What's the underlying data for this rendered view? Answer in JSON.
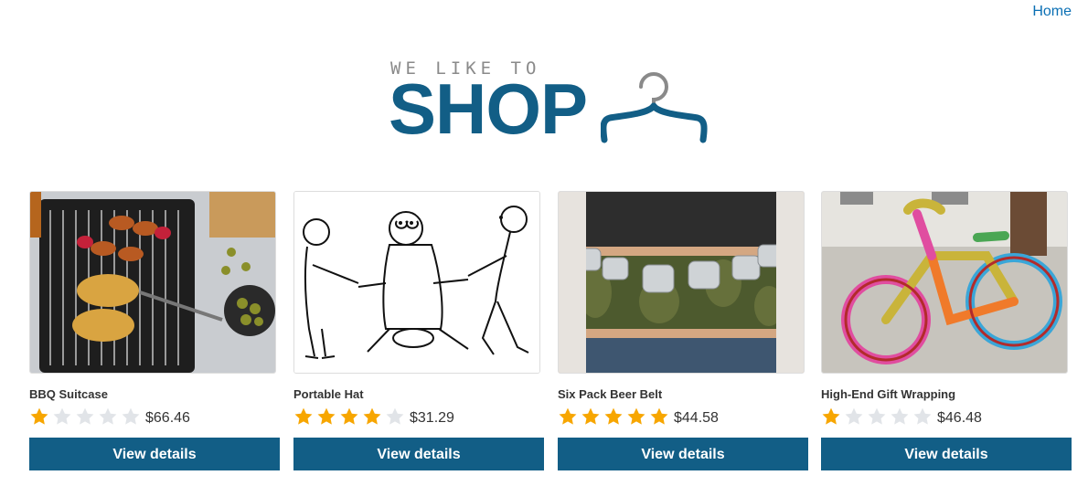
{
  "nav": {
    "home_label": "Home"
  },
  "logo": {
    "tagline": "WE LIKE TO",
    "word": "SHOP",
    "icon": "hanger-icon"
  },
  "colors": {
    "brand": "#125e86",
    "link": "#0a6fb4",
    "star_on": "#f7a600",
    "star_off": "#e1e4e8"
  },
  "products": [
    {
      "name": "BBQ Suitcase",
      "rating": 1,
      "max_rating": 5,
      "price": "$66.46",
      "button": "View details",
      "image": "bbq-grill-image"
    },
    {
      "name": "Portable Hat",
      "rating": 4,
      "max_rating": 5,
      "price": "$31.29",
      "button": "View details",
      "image": "cartoon-sketch-image"
    },
    {
      "name": "Six Pack Beer Belt",
      "rating": 5,
      "max_rating": 5,
      "price": "$44.58",
      "button": "View details",
      "image": "beer-belt-image"
    },
    {
      "name": "High-End Gift Wrapping",
      "rating": 1,
      "max_rating": 5,
      "price": "$46.48",
      "button": "View details",
      "image": "knitted-bike-image"
    }
  ]
}
